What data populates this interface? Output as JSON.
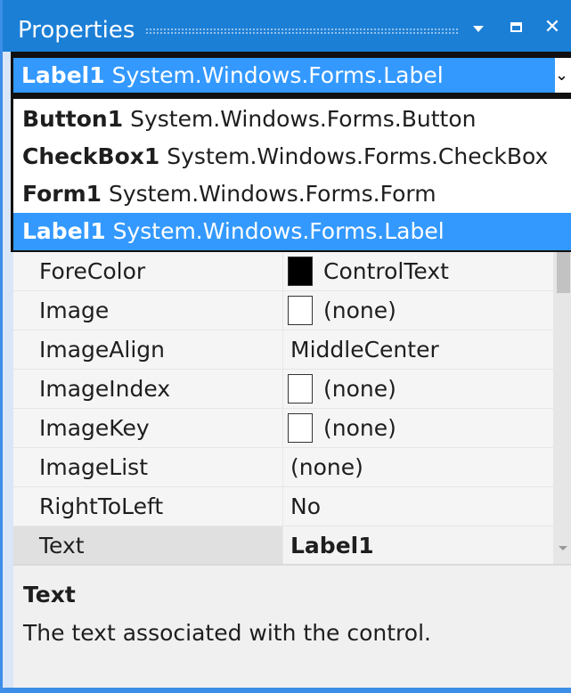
{
  "window": {
    "title": "Properties",
    "buttons": {
      "dropdown": "window-position-dropdown",
      "maximize": "maximize",
      "close": "close"
    }
  },
  "object_selector": {
    "selected_name": "Label1",
    "selected_type": "System.Windows.Forms.Label"
  },
  "dropdown_items": [
    {
      "name": "Button1",
      "type": "System.Windows.Forms.Button",
      "selected": false
    },
    {
      "name": "CheckBox1",
      "type": "System.Windows.Forms.CheckBox",
      "selected": false
    },
    {
      "name": "Form1",
      "type": "System.Windows.Forms.Form",
      "selected": false
    },
    {
      "name": "Label1",
      "type": "System.Windows.Forms.Label",
      "selected": true
    }
  ],
  "properties": [
    {
      "name": "ForeColor",
      "value": "ControlText",
      "swatch": "black"
    },
    {
      "name": "Image",
      "value": "(none)",
      "swatch": "empty"
    },
    {
      "name": "ImageAlign",
      "value": "MiddleCenter",
      "swatch": ""
    },
    {
      "name": "ImageIndex",
      "value": "(none)",
      "swatch": "empty"
    },
    {
      "name": "ImageKey",
      "value": "(none)",
      "swatch": "empty"
    },
    {
      "name": "ImageList",
      "value": "(none)",
      "swatch": ""
    },
    {
      "name": "RightToLeft",
      "value": "No",
      "swatch": ""
    },
    {
      "name": "Text",
      "value": "Label1",
      "swatch": "",
      "bold": true,
      "selected": true
    }
  ],
  "description": {
    "title": "Text",
    "text": "The text associated with the control."
  },
  "colors": {
    "title_bar": "#1c7fd6",
    "selection": "#3399ff",
    "grid_background": "#f5f5f5"
  }
}
